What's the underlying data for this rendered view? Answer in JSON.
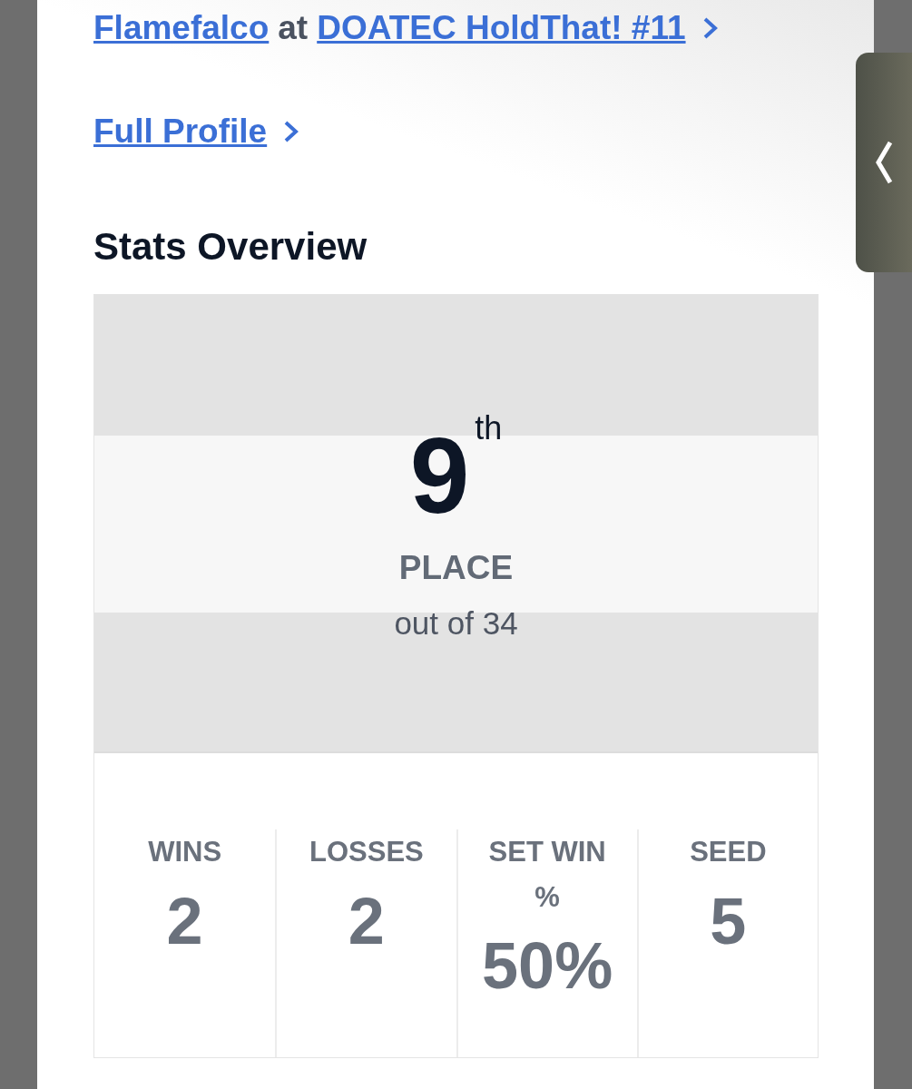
{
  "event_link": {
    "player": "Flamefalco",
    "connector": "at",
    "event": "DOATEC HoldThat! #11"
  },
  "profile_link": {
    "label": "Full Profile"
  },
  "section_title": "Stats Overview",
  "placement": {
    "number": "9",
    "suffix": "th",
    "label": "PLACE",
    "out_of": "out of 34"
  },
  "stats": [
    {
      "label": "WINS",
      "value": "2"
    },
    {
      "label": "LOSSES",
      "value": "2"
    },
    {
      "label": "SET WIN %",
      "value": "50%"
    },
    {
      "label": "SEED",
      "value": "5"
    }
  ]
}
